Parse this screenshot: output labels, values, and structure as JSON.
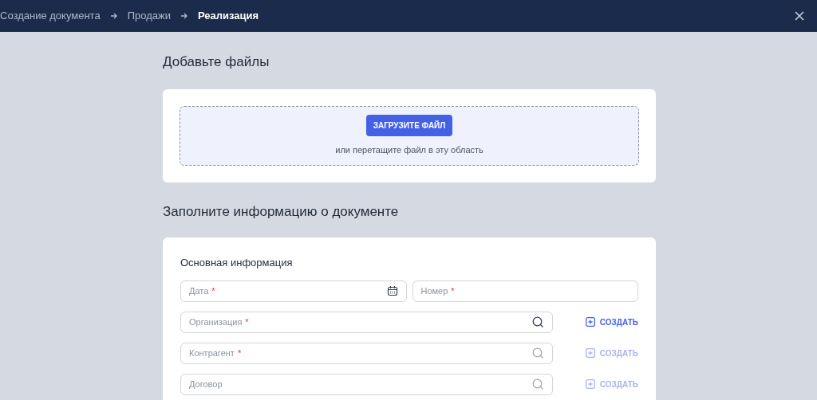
{
  "breadcrumbs": [
    {
      "label": "Создание документа",
      "current": false
    },
    {
      "label": "Продажи",
      "current": false
    },
    {
      "label": "Реализация",
      "current": true
    }
  ],
  "upload": {
    "title": "Добавьте файлы",
    "button": "ЗАГРУЗИТЕ ФАЙЛ",
    "hint": "или перетащите файл в эту область"
  },
  "form": {
    "title": "Заполните информацию о документе",
    "section": "Основная информация",
    "top_fields": [
      {
        "placeholder": "Дата",
        "required_mark": "*",
        "kind": "date"
      },
      {
        "placeholder": "Номер",
        "required_mark": "*",
        "kind": "text"
      }
    ],
    "lookup_fields": [
      {
        "placeholder": "Организация",
        "required_mark": "*",
        "create": "СОЗДАТЬ",
        "disabled": false
      },
      {
        "placeholder": "Контрагент",
        "required_mark": "*",
        "create": "СОЗДАТЬ",
        "disabled": true
      },
      {
        "placeholder": "Договор",
        "create": "СОЗДАТЬ",
        "disabled": true
      }
    ]
  }
}
